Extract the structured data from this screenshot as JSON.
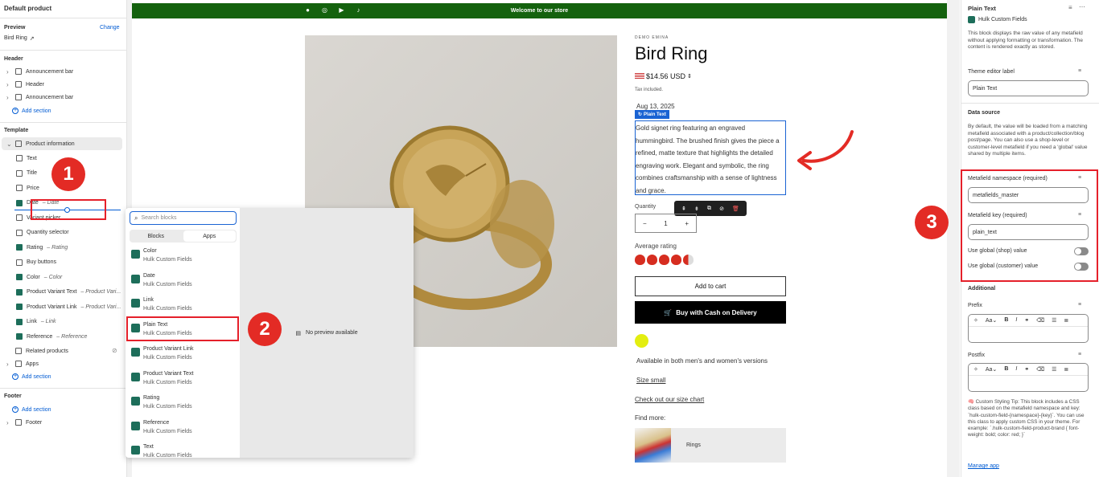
{
  "left": {
    "title": "Default product",
    "preview_label": "Preview",
    "change_label": "Change",
    "preview_value": "Bird Ring",
    "header_title": "Header",
    "header_items": [
      "Announcement bar",
      "Header",
      "Announcement bar"
    ],
    "add_section": "Add section",
    "template_title": "Template",
    "product_information": "Product information",
    "template_items": [
      {
        "label": "Text",
        "sub": ""
      },
      {
        "label": "Title",
        "sub": ""
      },
      {
        "label": "Price",
        "sub": ""
      },
      {
        "label": "Date",
        "sub": "– Date"
      },
      {
        "label": "Variant picker",
        "sub": ""
      },
      {
        "label": "Quantity selector",
        "sub": ""
      },
      {
        "label": "Rating",
        "sub": "– Rating"
      },
      {
        "label": "Buy buttons",
        "sub": ""
      },
      {
        "label": "Color",
        "sub": "– Color"
      },
      {
        "label": "Product Variant Text",
        "sub": "– Product Vari..."
      },
      {
        "label": "Product Variant Link",
        "sub": "– Product Vari..."
      },
      {
        "label": "Link",
        "sub": "– Link"
      },
      {
        "label": "Reference",
        "sub": "– Reference"
      }
    ],
    "related_products": "Related products",
    "apps": "Apps",
    "footer_title": "Footer",
    "footer_item": "Footer"
  },
  "store": {
    "announcement": "Welcome to our store",
    "vendor": "DEMO EMINA",
    "title": "Bird Ring",
    "price": "$14.56 USD",
    "tax": "Tax included.",
    "date": "Aug 13, 2025",
    "plain_text_tag": "Plain Text",
    "description": "Gold signet ring featuring an engraved hummingbird. The brushed finish gives the piece a refined, matte texture that highlights the detailed engraving work. Elegant and symbolic, the ring combines craftsmanship with a sense of lightness and grace.",
    "quantity_label": "Quantity",
    "quantity_minus": "−",
    "quantity_value": "1",
    "quantity_plus": "+",
    "rating_label": "Average rating",
    "rating_value": 4.5,
    "add_to_cart": "Add to cart",
    "buy_cod": "Buy with Cash on Delivery",
    "color_swatch": "#e3ee10",
    "variant_text": "Available in both men's and women's versions",
    "size_link": "Size small",
    "size_chart_link": "Check out our size chart",
    "find_more": "Find more:",
    "reference_item": "Rings"
  },
  "picker": {
    "search_placeholder": "Search blocks",
    "tab_blocks": "Blocks",
    "tab_apps": "Apps",
    "items": [
      {
        "title": "Color",
        "sub": "Hulk Custom Fields"
      },
      {
        "title": "Date",
        "sub": "Hulk Custom Fields"
      },
      {
        "title": "Link",
        "sub": "Hulk Custom Fields"
      },
      {
        "title": "Plain Text",
        "sub": "Hulk Custom Fields"
      },
      {
        "title": "Product Variant Link",
        "sub": "Hulk Custom Fields"
      },
      {
        "title": "Product Variant Text",
        "sub": "Hulk Custom Fields"
      },
      {
        "title": "Rating",
        "sub": "Hulk Custom Fields"
      },
      {
        "title": "Reference",
        "sub": "Hulk Custom Fields"
      },
      {
        "title": "Text",
        "sub": "Hulk Custom Fields"
      }
    ],
    "no_preview": "No preview available"
  },
  "right": {
    "title": "Plain Text",
    "app_name": "Hulk Custom Fields",
    "description": "This block displays the raw value of any metafield without applying formatting or transformation. The content is rendered exactly as stored.",
    "editor_label": "Theme editor label",
    "editor_value": "Plain Text",
    "data_source": "Data source",
    "data_source_desc": "By default, the value will be loaded from a matching metafield associated with a product/collection/blog post/page. You can also use a shop-level or customer-level metafield if you need a 'global' value shared by multiple items.",
    "ns_label": "Metafield namespace (required)",
    "ns_value": "metafields_master",
    "key_label": "Metafield key (required)",
    "key_value": "plain_text",
    "global_shop": "Use global (shop) value",
    "global_customer": "Use global (customer) value",
    "additional": "Additional",
    "prefix": "Prefix",
    "postfix": "Postfix",
    "tip": "🧠 Custom Styling Tip: This block includes a CSS class based on the metafield namespace and key: `hulk-custom-field-{namespace}-{key}`. You can use this class to apply custom CSS in your theme. For example: `.hulk-custom-field-product-brand { font-weight: bold; color: red; }`",
    "manage_app": "Manage app"
  },
  "badges": [
    "1",
    "2",
    "3"
  ],
  "colors": {
    "accent": "#005bd3",
    "annotation": "#e32b25",
    "announcement": "#14620e",
    "stars": "#d62d20"
  }
}
